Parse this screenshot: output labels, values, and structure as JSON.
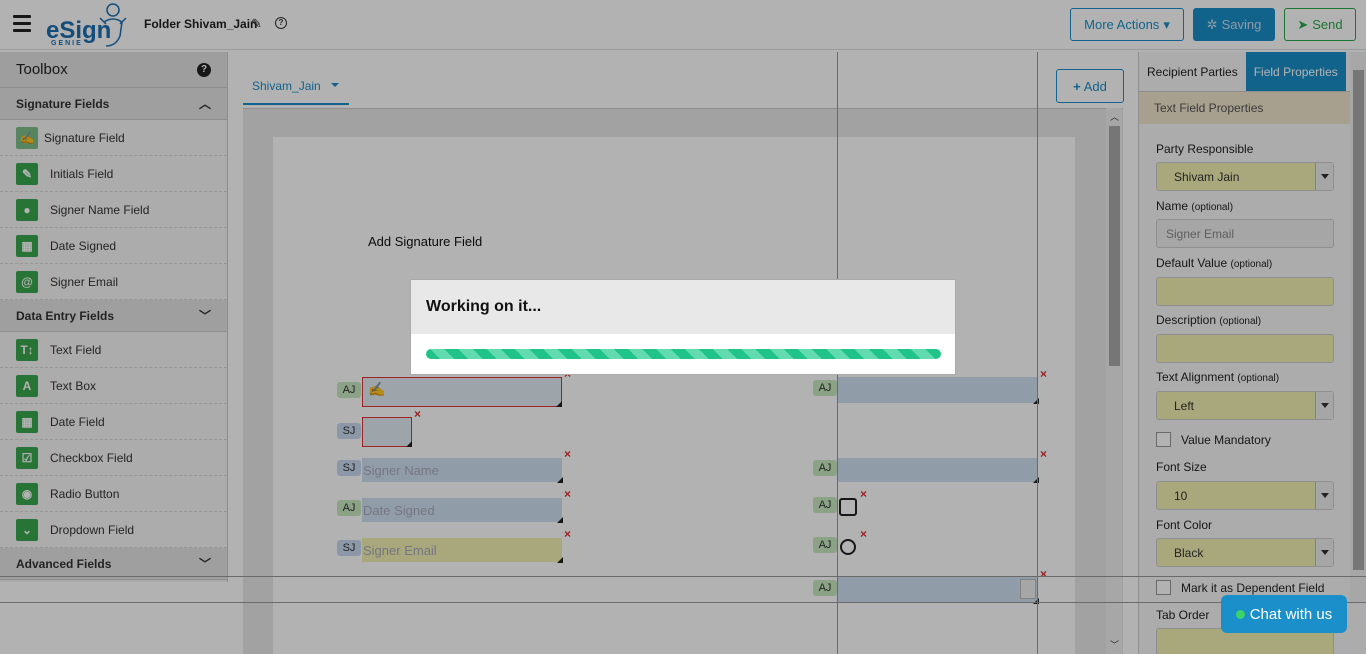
{
  "header": {
    "logo_text": "eSign",
    "logo_sub": "GENIE",
    "folder_title": "Folder Shivam_Jain",
    "more_actions": "More Actions",
    "saving": "Saving",
    "send": "Send"
  },
  "toolbox": {
    "title": "Toolbox",
    "sections": {
      "signature": {
        "label": "Signature Fields",
        "items": [
          "Signature Field",
          "Initials Field",
          "Signer Name Field",
          "Date Signed",
          "Signer Email"
        ]
      },
      "data_entry": {
        "label": "Data Entry Fields",
        "items": [
          "Text Field",
          "Text Box",
          "Date Field",
          "Checkbox Field",
          "Radio Button",
          "Dropdown Field"
        ]
      },
      "advanced": {
        "label": "Advanced Fields"
      }
    }
  },
  "canvas": {
    "tab": "Shivam_Jain",
    "add": "Add",
    "doc_heading": "Add Signature Field",
    "placeholders": {
      "signer_name": "Signer Name",
      "date_signed": "Date Signed",
      "signer_email": "Signer Email"
    },
    "tags": {
      "aj": "AJ",
      "sj": "SJ"
    }
  },
  "props": {
    "tab_recipients": "Recipient Parties",
    "tab_field_props": "Field Properties",
    "subheader": "Text Field Properties",
    "party_label": "Party Responsible",
    "party_value": "Shivam Jain",
    "name_label": "Name",
    "optional": "(optional)",
    "name_value": "Signer Email",
    "default_label": "Default Value",
    "desc_label": "Description",
    "align_label": "Text Alignment",
    "align_value": "Left",
    "mandatory": "Value Mandatory",
    "font_size_label": "Font Size",
    "font_size_value": "10",
    "font_color_label": "Font Color",
    "font_color_value": "Black",
    "dependent": "Mark it as Dependent Field",
    "tab_order": "Tab Order"
  },
  "modal": {
    "title": "Working on it...",
    "progress": 1.0
  },
  "chat": "Chat with us",
  "colors": {
    "accent": "#1a8fc9",
    "green": "#3aa64f",
    "progress": "#20c489"
  }
}
